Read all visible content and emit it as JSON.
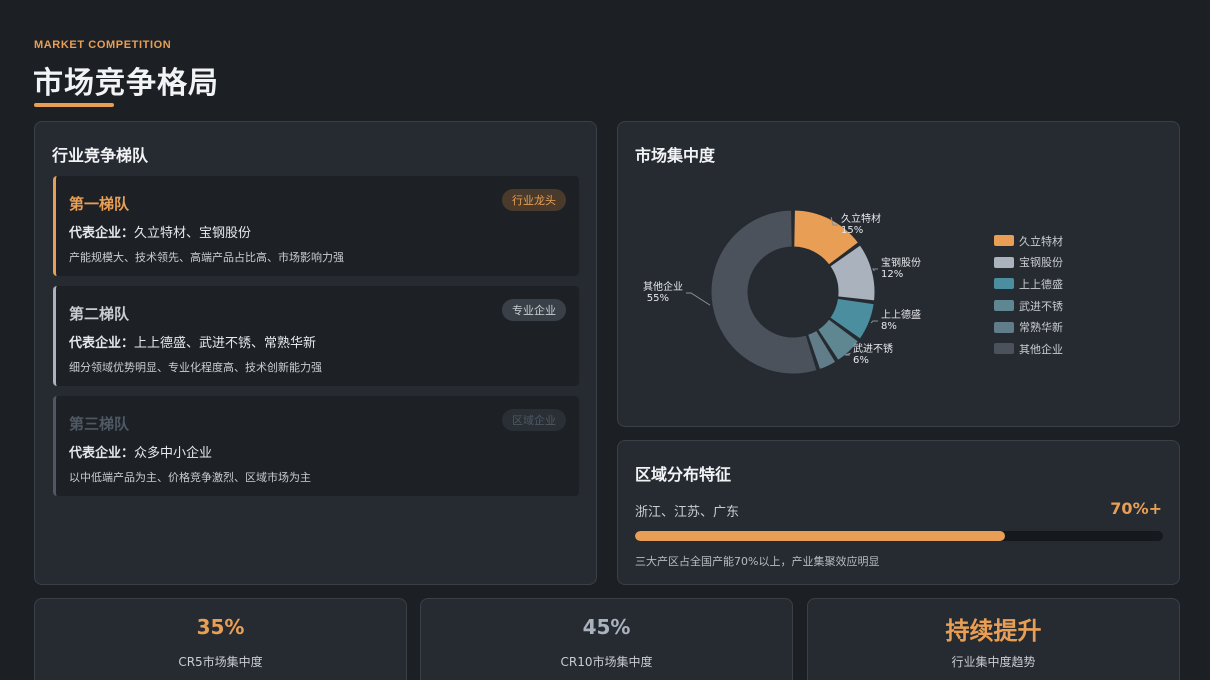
{
  "header": {
    "eyebrow": "MARKET COMPETITION",
    "title": "市场竞争格局"
  },
  "tiers_panel": {
    "title": "行业竞争梯队",
    "company_key": "代表企业：",
    "tiers": [
      {
        "name": "第一梯队",
        "badge": "行业龙头",
        "companies": "久立特材、宝钢股份",
        "desc": "产能规模大、技术领先、高端产品占比高、市场影响力强",
        "accent": "#e89f55"
      },
      {
        "name": "第二梯队",
        "badge": "专业企业",
        "companies": "上上德盛、武进不锈、常熟华新",
        "desc": "细分领域优势明显、专业化程度高、技术创新能力强",
        "accent": "#a9b2bd"
      },
      {
        "name": "第三梯队",
        "badge": "区域企业",
        "companies": "众多中小企业",
        "desc": "以中低端产品为主、价格竞争激烈、区域市场为主",
        "accent": "#4f5863"
      }
    ]
  },
  "concentration_panel": {
    "title": "市场集中度"
  },
  "chart_data": {
    "type": "pie",
    "variant": "donut",
    "categories": [
      "久立特材",
      "宝钢股份",
      "上上德盛",
      "武进不锈",
      "常熟华新",
      "其他企业"
    ],
    "values": [
      15,
      12,
      8,
      6,
      4,
      55
    ],
    "labels": [
      "15%",
      "12%",
      "8%",
      "6%",
      "",
      "55%"
    ],
    "colors": [
      "#e89f55",
      "#a9b2bd",
      "#4a8ea0",
      "#5e8791",
      "#627d8a",
      "#4b525c"
    ],
    "legend": "right"
  },
  "region_panel": {
    "title": "区域分布特征",
    "label": "浙江、江苏、广东",
    "value_text": "70%+",
    "progress": 0.7,
    "note": "三大产区占全国产能70%以上，产业集聚效应明显"
  },
  "stats": [
    {
      "value": "35%",
      "label": "CR5市场集中度",
      "color": "#e89f55"
    },
    {
      "value": "45%",
      "label": "CR10市场集中度",
      "color": "#a9b2bd"
    },
    {
      "value": "持续提升",
      "label": "行业集中度趋势",
      "color": "#e89f55"
    }
  ]
}
